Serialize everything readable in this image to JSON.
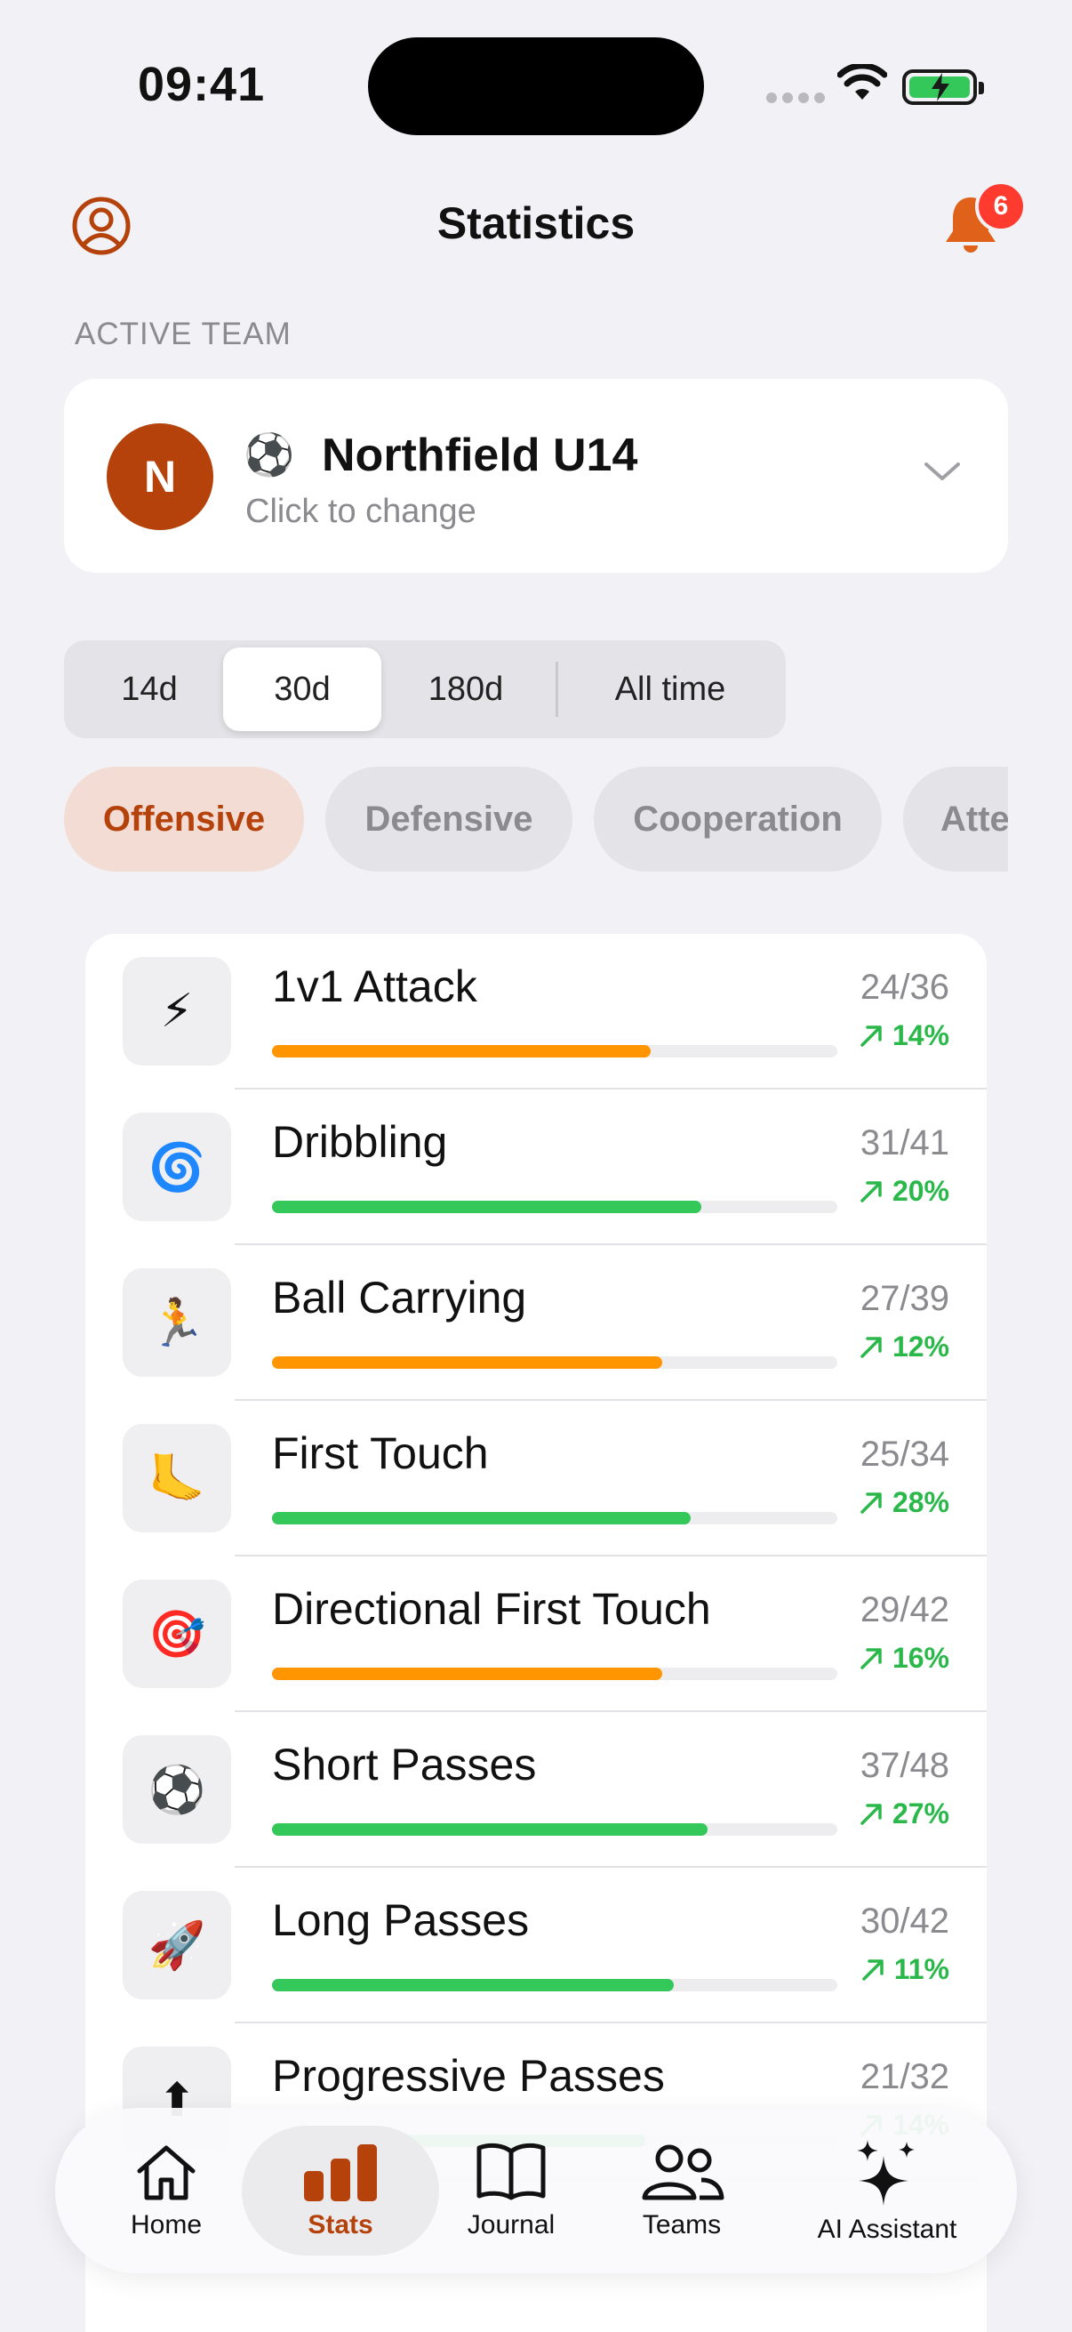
{
  "status": {
    "time": "09:41"
  },
  "header": {
    "title": "Statistics",
    "notification_count": "6"
  },
  "active_team": {
    "section_label": "ACTIVE TEAM",
    "initial": "N",
    "emoji": "⚽",
    "name": "Northfield U14",
    "subtitle": "Click to change"
  },
  "periods": [
    {
      "label": "14d",
      "active": false
    },
    {
      "label": "30d",
      "active": true
    },
    {
      "label": "180d",
      "active": false
    },
    {
      "label": "All time",
      "active": false
    }
  ],
  "categories": [
    {
      "label": "Offensive",
      "active": true
    },
    {
      "label": "Defensive",
      "active": false
    },
    {
      "label": "Cooperation",
      "active": false
    },
    {
      "label": "Atte",
      "active": false
    }
  ],
  "colors": {
    "accent": "#B5410B",
    "orange": "#FF9500",
    "green": "#34C759",
    "trend_up": "#2BB84A"
  },
  "stats": [
    {
      "name": "1v1 Attack",
      "icon": "⚡",
      "count": "24/36",
      "trend": "14%",
      "progress": 0.67,
      "color": "orange"
    },
    {
      "name": "Dribbling",
      "icon": "🌀",
      "count": "31/41",
      "trend": "20%",
      "progress": 0.76,
      "color": "green"
    },
    {
      "name": "Ball Carrying",
      "icon": "🏃",
      "count": "27/39",
      "trend": "12%",
      "progress": 0.69,
      "color": "orange"
    },
    {
      "name": "First Touch",
      "icon": "🦶",
      "count": "25/34",
      "trend": "28%",
      "progress": 0.74,
      "color": "green"
    },
    {
      "name": "Directional First Touch",
      "icon": "🎯",
      "count": "29/42",
      "trend": "16%",
      "progress": 0.69,
      "color": "orange"
    },
    {
      "name": "Short Passes",
      "icon": "⚽",
      "count": "37/48",
      "trend": "27%",
      "progress": 0.77,
      "color": "green"
    },
    {
      "name": "Long Passes",
      "icon": "🚀",
      "count": "30/42",
      "trend": "11%",
      "progress": 0.71,
      "color": "green"
    },
    {
      "name": "Progressive Passes",
      "icon": "⬆",
      "count": "21/32",
      "trend": "14%",
      "progress": 0.66,
      "color": "green"
    }
  ],
  "tabs": [
    {
      "label": "Home",
      "icon": "house-icon",
      "active": false
    },
    {
      "label": "Stats",
      "icon": "chart-bars-icon",
      "active": true
    },
    {
      "label": "Journal",
      "icon": "book-icon",
      "active": false
    },
    {
      "label": "Teams",
      "icon": "people-icon",
      "active": false
    },
    {
      "label": "AI Assistant",
      "icon": "sparkles-icon",
      "active": false
    }
  ]
}
